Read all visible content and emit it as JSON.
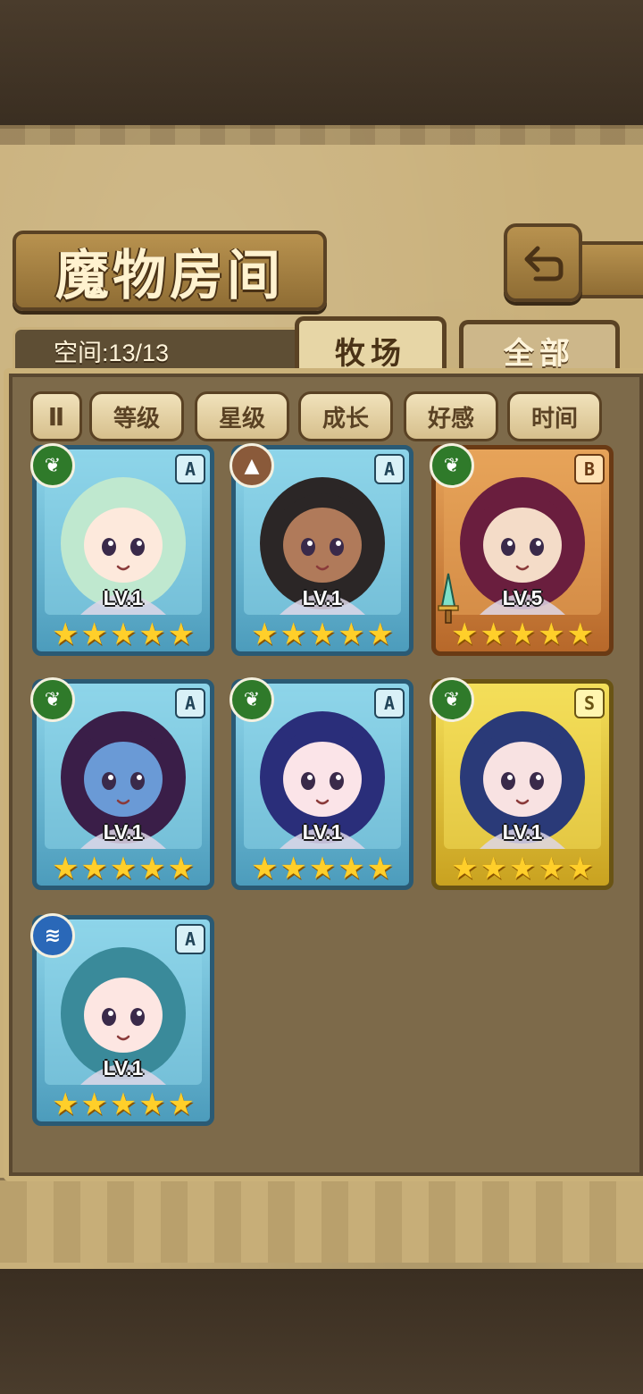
{
  "header": {
    "title": "魔物房间",
    "back_icon": "return-arrow-icon"
  },
  "inventory": {
    "space_label": "空间:13/13"
  },
  "tabs": [
    {
      "label": "牧场",
      "active": true
    },
    {
      "label": "全部",
      "active": false
    }
  ],
  "filters": {
    "sort_icon": "sort-toggle-icon",
    "sort_glyph": "Ⅱ",
    "buttons": [
      "等级",
      "星级",
      "成长",
      "好感",
      "时间"
    ]
  },
  "monsters": [
    {
      "element": "nature",
      "element_icon": "leaf-icon",
      "rank": "A",
      "level": "LV.1",
      "stars": 5,
      "frame_color": "#8ed5ea",
      "hair": "#bfe8cf",
      "skin": "#fde9dc"
    },
    {
      "element": "earth",
      "element_icon": "mountain-icon",
      "rank": "A",
      "level": "LV.1",
      "stars": 5,
      "frame_color": "#8ed5ea",
      "hair": "#2b2626",
      "skin": "#b07a5a"
    },
    {
      "element": "nature",
      "element_icon": "leaf-icon",
      "rank": "B",
      "level": "LV.5",
      "stars": 5,
      "frame_color": "#e7a45a",
      "hair": "#6a1e3e",
      "skin": "#f4dcc8",
      "weapon": true
    },
    {
      "element": "nature",
      "element_icon": "leaf-icon",
      "rank": "A",
      "level": "LV.1",
      "stars": 5,
      "frame_color": "#8ed5ea",
      "hair": "#3a1e48",
      "skin": "#6a9ad6"
    },
    {
      "element": "nature",
      "element_icon": "leaf-icon",
      "rank": "A",
      "level": "LV.1",
      "stars": 5,
      "frame_color": "#8ed5ea",
      "hair": "#2a2e7a",
      "skin": "#fbe4e8"
    },
    {
      "element": "nature",
      "element_icon": "leaf-icon",
      "rank": "S",
      "level": "LV.1",
      "stars": 5,
      "frame_color": "#f4df5a",
      "hair": "#2a3a78",
      "skin": "#f8e2e2"
    },
    {
      "element": "water",
      "element_icon": "waves-icon",
      "rank": "A",
      "level": "LV.1",
      "stars": 5,
      "frame_color": "#8ed5ea",
      "hair": "#3a8a9a",
      "skin": "#fde6e2"
    }
  ]
}
